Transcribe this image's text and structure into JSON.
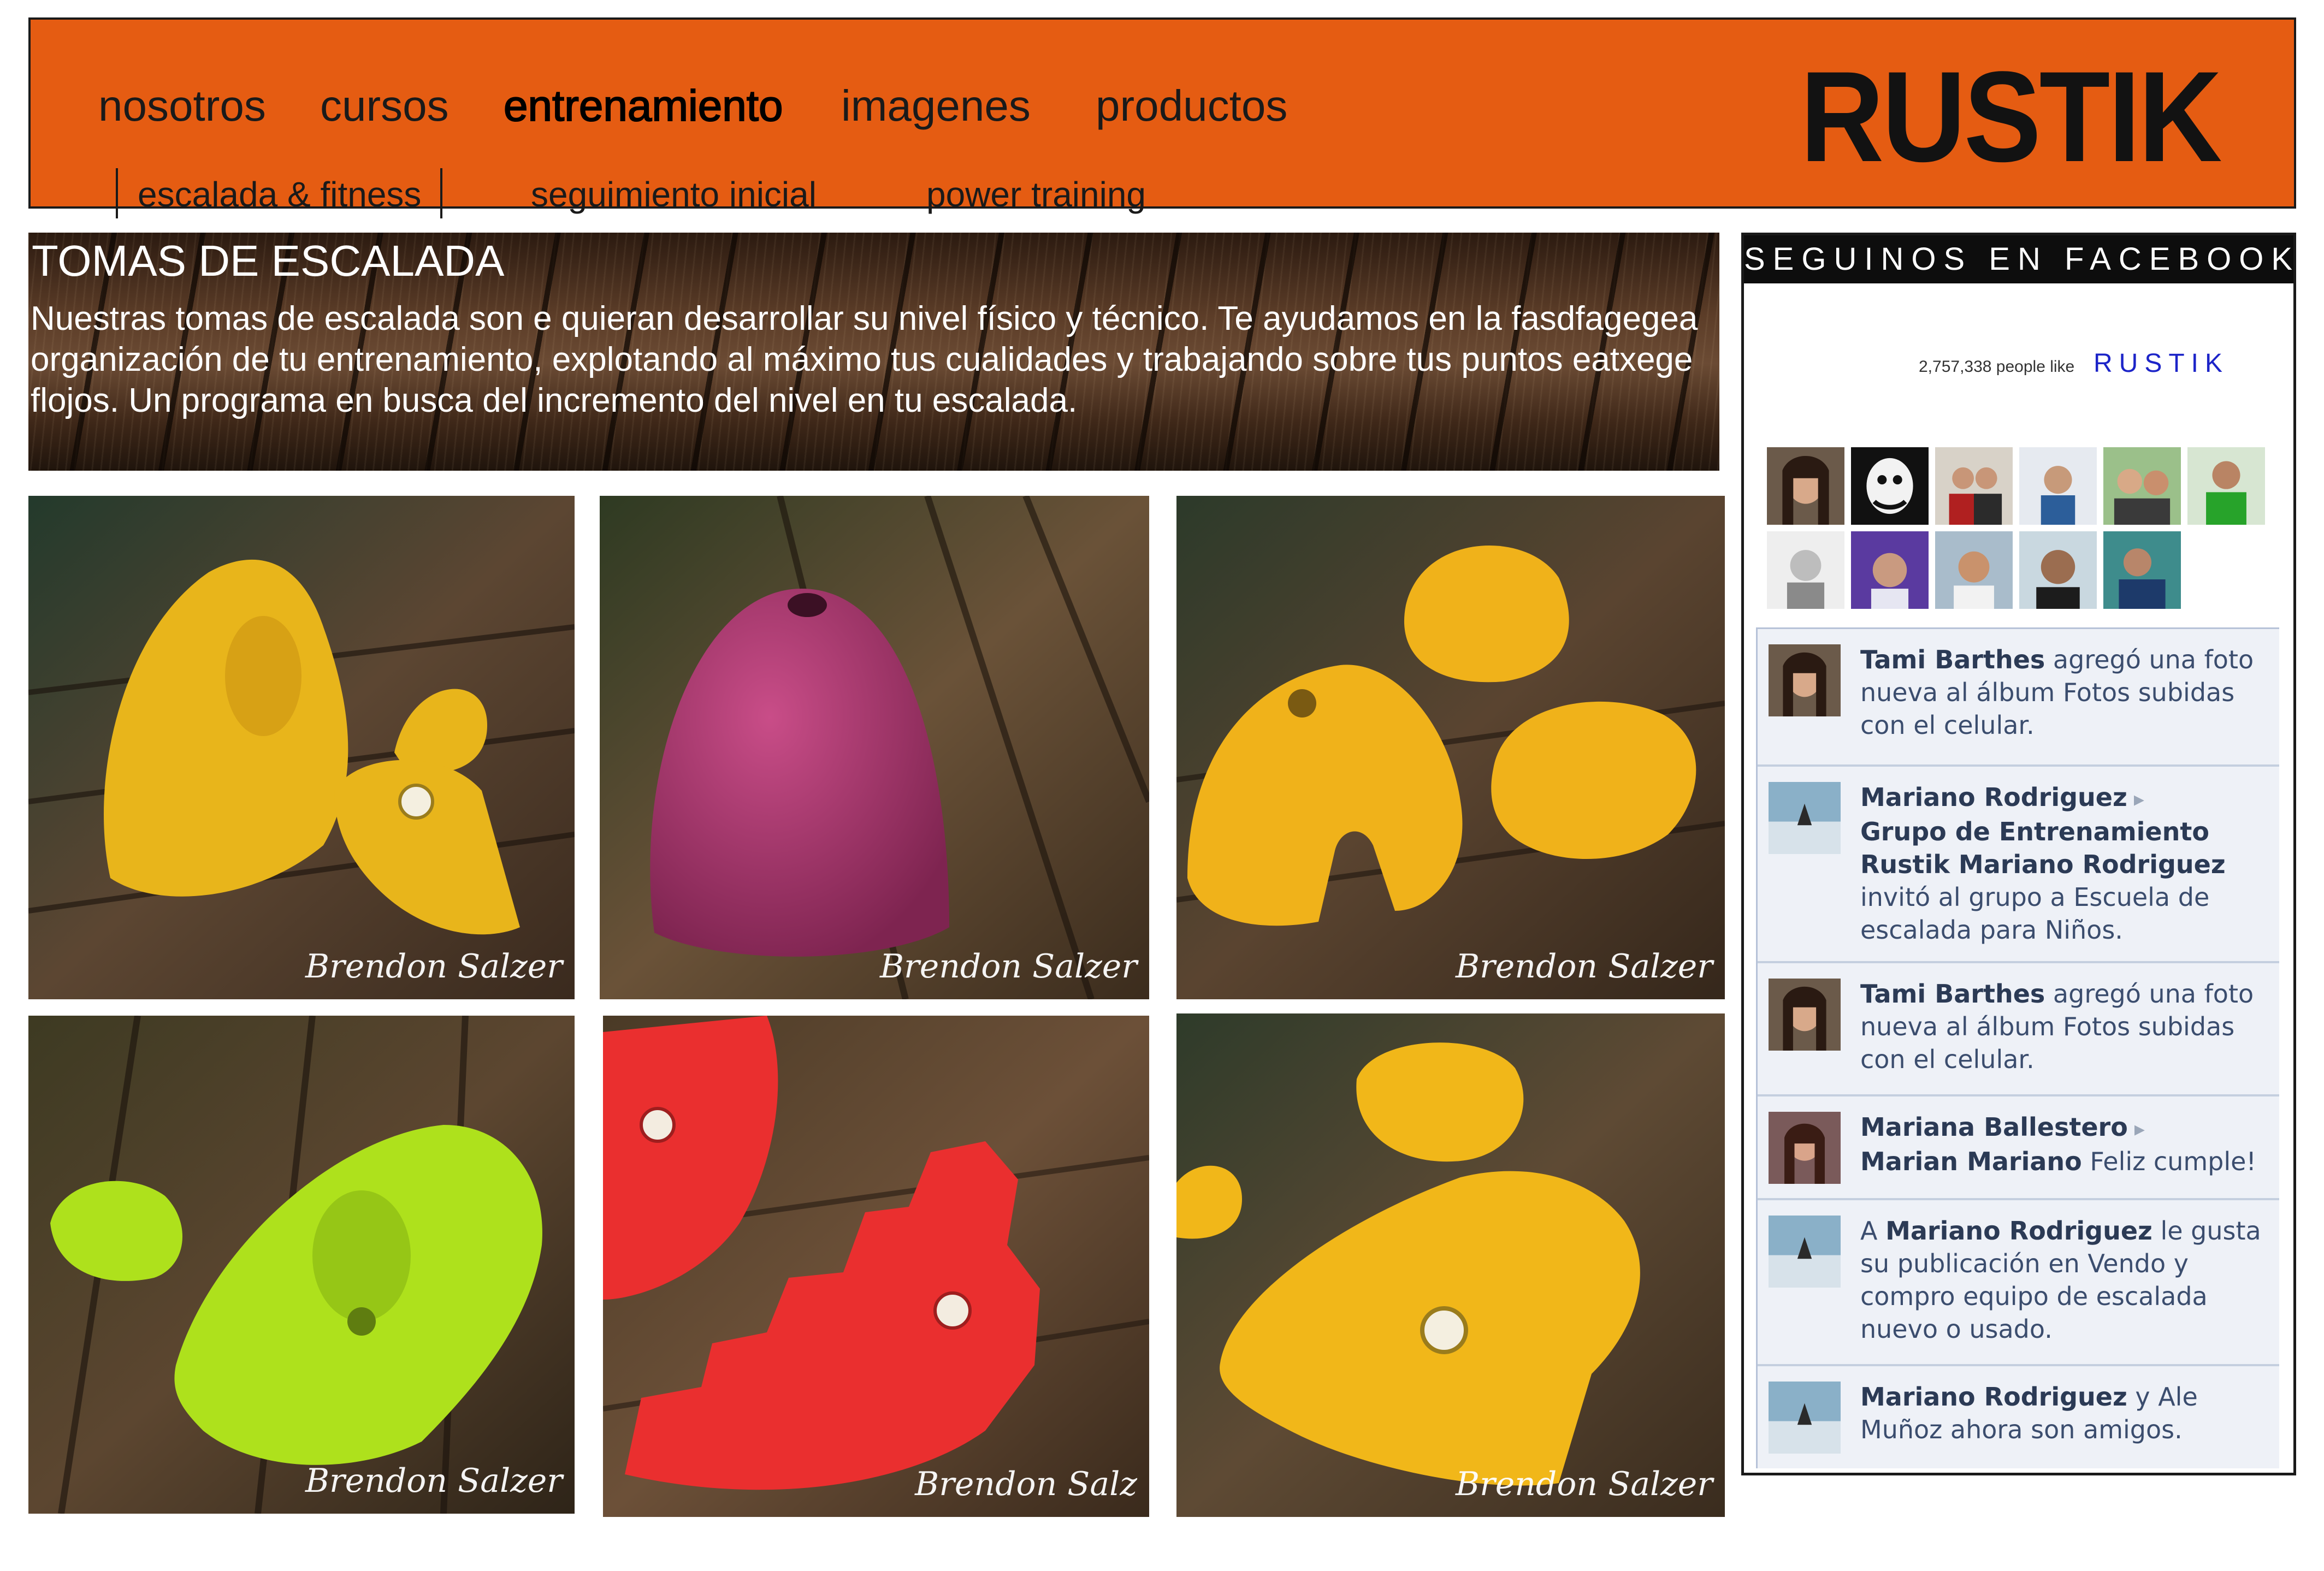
{
  "brand": {
    "logo": "RUSTIK",
    "accent_color": "#e55c12"
  },
  "nav": {
    "items": [
      {
        "label": "nosotros",
        "active": false
      },
      {
        "label": "cursos",
        "active": false
      },
      {
        "label": "entrenamiento",
        "active": true
      },
      {
        "label": "imagenes",
        "active": false
      },
      {
        "label": "productos",
        "active": false
      }
    ],
    "subitems": [
      {
        "label": "escalada & fitness"
      },
      {
        "label": "seguimiento inicial"
      },
      {
        "label": "power training"
      }
    ]
  },
  "intro": {
    "title": "TOMAS DE ESCALADA",
    "text": "Nuestras tomas de escalada son e quieran desarrollar su nivel físico y técnico. Te ayudamos en la fasdfagegea organización de tu entrenamiento, explotando al máximo tus cualidades y trabajando sobre tus puntos eatxege flojos. Un programa en busca del incremento del nivel en tu escalada."
  },
  "gallery": {
    "photos": [
      {
        "credit": "Brendon Salzer",
        "hold_color": "#e8b51b"
      },
      {
        "credit": "Brendon Salzer",
        "hold_color": "#b03a74"
      },
      {
        "credit": "Brendon Salzer",
        "hold_color": "#f0b21a"
      },
      {
        "credit": "Brendon Salzer",
        "hold_color": "#aee11c"
      },
      {
        "credit": "Brendon Salz",
        "hold_color": "#ea2f2f"
      },
      {
        "credit": "Brendon Salzer",
        "hold_color": "#f1b719"
      }
    ]
  },
  "facebook": {
    "header": "SEGUINOS EN FACEBOOK",
    "likes_text": "2,757,338 people like",
    "page_name": "RUSTIK",
    "link_color": "#1c24c8",
    "stories": [
      {
        "actor": "Tami Barthes",
        "arrow": "",
        "target": "",
        "text": " agregó una foto nueva al álbum Fotos subidas con el celular."
      },
      {
        "actor": "Mariano Rodriguez",
        "arrow": " ▸",
        "target": "Grupo de Entrenamiento Rustik Mariano Rodriguez",
        "text": " invitó al grupo a Escuela de escalada para Niños."
      },
      {
        "actor": "Tami Barthes",
        "arrow": "",
        "target": "",
        "text": " agregó una foto nueva al álbum Fotos subidas con el celular."
      },
      {
        "actor": "Mariana Ballestero",
        "arrow": " ▸",
        "target": "Marian Mariano",
        "text": " Feliz cumple!"
      },
      {
        "prefix": "A ",
        "actor": "Mariano Rodriguez",
        "arrow": "",
        "target": "",
        "text": " le gusta su publicación en Vendo y compro equipo de escalada nuevo o usado."
      },
      {
        "actor": "Mariano Rodriguez",
        "arrow": "",
        "target": "",
        "text": " y Ale Muñoz ahora son amigos."
      }
    ]
  }
}
